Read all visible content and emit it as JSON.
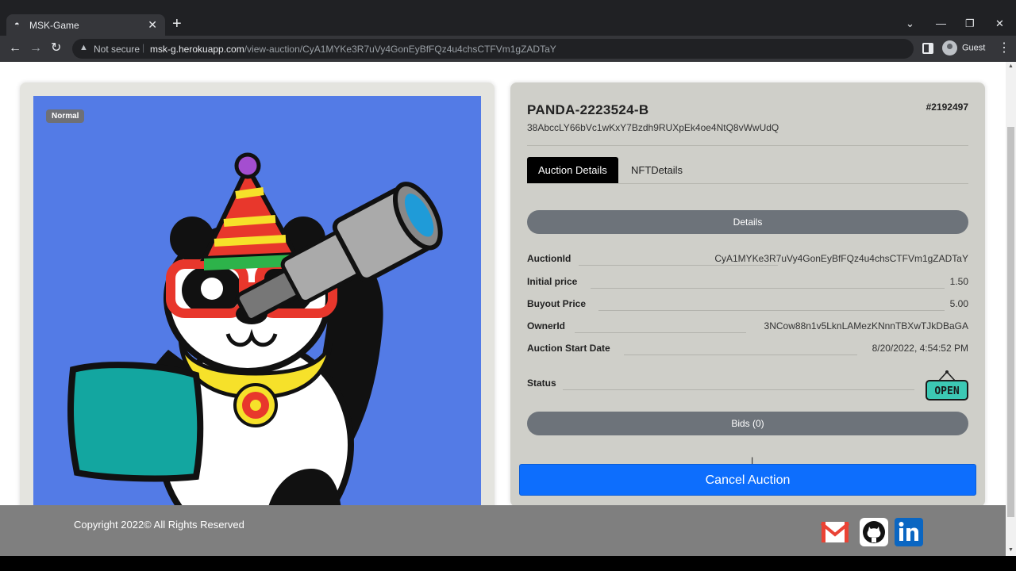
{
  "browser": {
    "tab_title": "MSK-Game",
    "address_warning": "Not secure",
    "url_host": "msk-g.herokuapp.com",
    "url_path": "/view-auction/CyA1MYKe3R7uVy4GonEyBfFQz4u4chsCTFVm1gZADTaY",
    "profile_label": "Guest"
  },
  "nft": {
    "rarity": "Normal",
    "name": "PANDA-2223524-B",
    "address": "38AbccLY66bVc1wKxY7Bzdh9RUXpEk4oe4NtQ8vWwUdQ",
    "number": "#2192497",
    "art_background": "#537be6"
  },
  "tabs": {
    "auction_details": "Auction Details",
    "nft_details": "NFTDetails"
  },
  "details_header": "Details",
  "auction": {
    "auction_id_label": "AuctionId",
    "auction_id": "CyA1MYKe3R7uVy4GonEyBfFQz4u4chsCTFVm1gZADTaY",
    "initial_price_label": "Initial price",
    "initial_price": "1.50",
    "buyout_price_label": "Buyout Price",
    "buyout_price": "5.00",
    "owner_id_label": "OwnerId",
    "owner_id": "3NCow88n1v5LknLAMezKNnnTBXwTJkDBaGA",
    "start_date_label": "Auction Start Date",
    "start_date": "8/20/2022, 4:54:52 PM",
    "status_label": "Status",
    "status_sign": "OPEN"
  },
  "bids_header": "Bids (0)",
  "cancel_button": "Cancel Auction",
  "footer": {
    "copyright": "Copyright 2022© All Rights Reserved",
    "social_icons": [
      "gmail-icon",
      "github-icon",
      "linkedin-icon"
    ]
  },
  "colors": {
    "primary_button": "#0d6efd",
    "card_background": "#cfcfc9",
    "footer_background": "#7f7f7f",
    "open_sign": "#3cc8b4"
  }
}
